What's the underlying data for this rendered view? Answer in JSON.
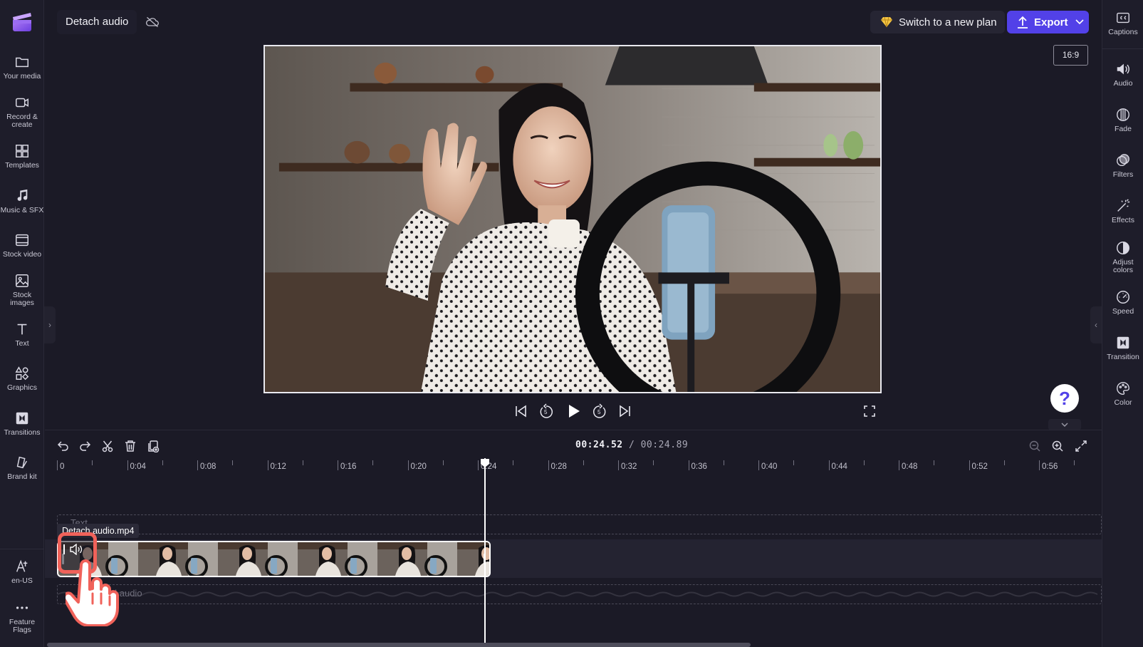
{
  "header": {
    "project_title": "Detach audio",
    "plan_button": "Switch to a new plan",
    "export_button": "Export",
    "aspect_ratio": "16:9"
  },
  "left_nav": [
    {
      "label": "Your media",
      "icon": "folder-icon"
    },
    {
      "label": "Record & create",
      "icon": "camera-icon"
    },
    {
      "label": "Templates",
      "icon": "templates-icon"
    },
    {
      "label": "Music & SFX",
      "icon": "music-icon"
    },
    {
      "label": "Stock video",
      "icon": "film-icon"
    },
    {
      "label": "Stock images",
      "icon": "image-icon"
    },
    {
      "label": "Text",
      "icon": "text-icon"
    },
    {
      "label": "Graphics",
      "icon": "shapes-icon"
    },
    {
      "label": "Transitions",
      "icon": "transitions-icon"
    },
    {
      "label": "Brand kit",
      "icon": "brand-kit-icon"
    },
    {
      "label": "en-US",
      "icon": "language-icon"
    },
    {
      "label": "Feature Flags",
      "icon": "more-icon"
    }
  ],
  "right_nav": [
    {
      "label": "Captions",
      "icon": "captions-icon"
    },
    {
      "label": "Audio",
      "icon": "speaker-icon"
    },
    {
      "label": "Fade",
      "icon": "fade-icon"
    },
    {
      "label": "Filters",
      "icon": "filters-icon"
    },
    {
      "label": "Effects",
      "icon": "magic-wand-icon"
    },
    {
      "label": "Adjust colors",
      "icon": "contrast-icon"
    },
    {
      "label": "Speed",
      "icon": "speedometer-icon"
    },
    {
      "label": "Transition",
      "icon": "transition-icon"
    },
    {
      "label": "Color",
      "icon": "palette-icon"
    }
  ],
  "help_button": "?",
  "timeline": {
    "current_time": "00:24.52",
    "separator": " / ",
    "total_time": "00:24.89",
    "ruler_labels": [
      "0",
      "0:04",
      "0:08",
      "0:12",
      "0:16",
      "0:20",
      "0:24",
      "0:28",
      "0:32",
      "0:36",
      "0:40",
      "0:44",
      "0:48",
      "0:52",
      "0:56"
    ],
    "clip_name": "Detach audio.mp4",
    "text_track_placeholder": "Text",
    "audio_track_placeholder": "Add audio"
  },
  "colors": {
    "accent": "#5241e8",
    "background": "#1b1a26",
    "highlight": "#f0625a"
  }
}
